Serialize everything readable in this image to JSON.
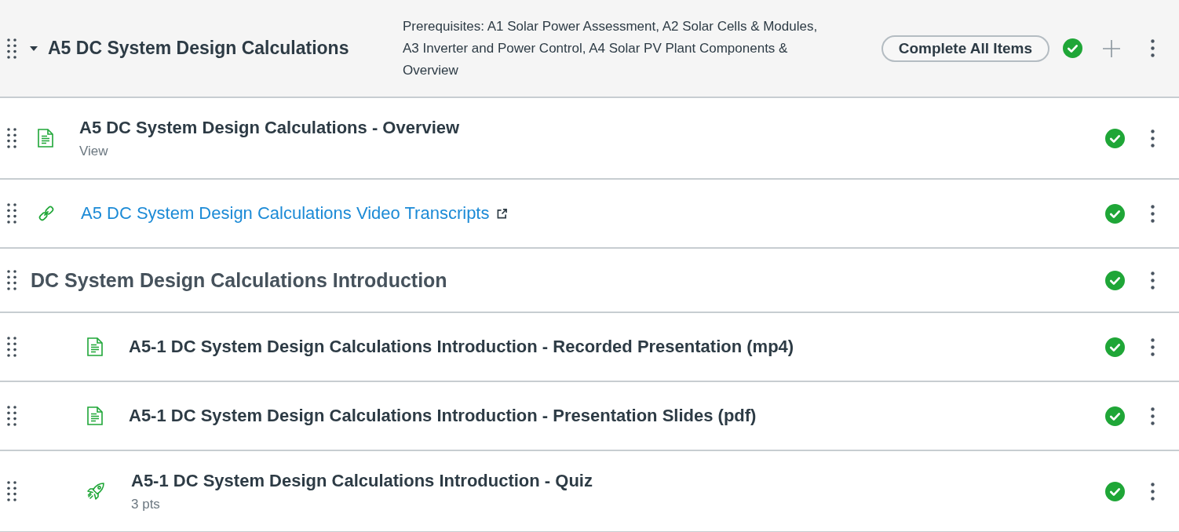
{
  "module": {
    "title": "A5 DC System Design Calculations",
    "expanded": true,
    "prerequisites": "Prerequisites: A1 Solar Power Assessment, A2 Solar Cells & Modules, A3 Inverter and Power Control, A4 Solar PV Plant Components & Overview",
    "complete_button": "Complete All Items",
    "completed": true
  },
  "items": [
    {
      "kind": "page",
      "title": "A5 DC System Design Calculations - Overview",
      "subtitle": "View",
      "completed": true
    },
    {
      "kind": "external_link",
      "title": "A5 DC System Design Calculations Video Transcripts",
      "completed": true
    },
    {
      "kind": "subheader",
      "title": "DC System Design Calculations Introduction",
      "completed": true,
      "children": [
        {
          "kind": "page",
          "title": "A5-1 DC System Design Calculations Introduction - Recorded Presentation (mp4)",
          "completed": true
        },
        {
          "kind": "page",
          "title": "A5-1 DC System Design Calculations Introduction - Presentation Slides (pdf)",
          "completed": true
        },
        {
          "kind": "quiz",
          "title": "A5-1 DC System Design Calculations Introduction - Quiz",
          "subtitle": "3 pts",
          "completed": true
        }
      ]
    }
  ]
}
